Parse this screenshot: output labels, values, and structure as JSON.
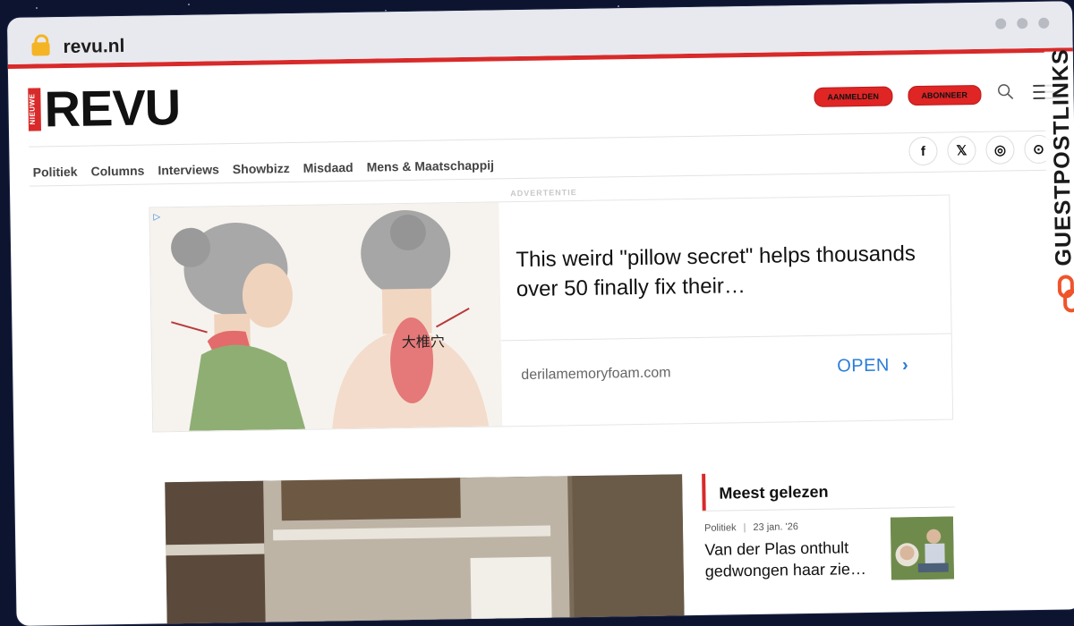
{
  "browser": {
    "url": "revu.nl"
  },
  "header": {
    "logo_tag": "NIEUWE",
    "logo_word": "REVU",
    "login_label": "AANMELDEN",
    "subscribe_label": "ABONNEER"
  },
  "nav": {
    "items": [
      {
        "label": "Politiek"
      },
      {
        "label": "Columns"
      },
      {
        "label": "Interviews"
      },
      {
        "label": "Showbizz"
      },
      {
        "label": "Misdaad"
      },
      {
        "label": "Mens & Maatschappij"
      }
    ]
  },
  "socials": [
    {
      "icon": "facebook-icon",
      "glyph": "f"
    },
    {
      "icon": "x-icon",
      "glyph": "𝕏"
    },
    {
      "icon": "instagram-icon",
      "glyph": "◎"
    },
    {
      "icon": "rss-icon",
      "glyph": "⊙"
    }
  ],
  "ad": {
    "label": "ADVERTENTIE",
    "info_glyph": "▷",
    "headline": "This weird \"pillow secret\" helps thousands over 50 finally fix their…",
    "domain": "derilamemoryfoam.com",
    "cta": "OPEN",
    "cta_glyph": "›",
    "art_text": "大椎穴"
  },
  "sidebar": {
    "title": "Meest gelezen",
    "article": {
      "category": "Politiek",
      "separator": "|",
      "date": "23 jan. '26",
      "title": "Van der Plas onthult gedwongen haar zie…"
    }
  },
  "watermark": {
    "text": "GUESTPOSTLINKS"
  },
  "colors": {
    "accent": "#d82a2a",
    "link": "#2a7dd8",
    "lock": "#f4b423",
    "background": "#0d1430"
  }
}
